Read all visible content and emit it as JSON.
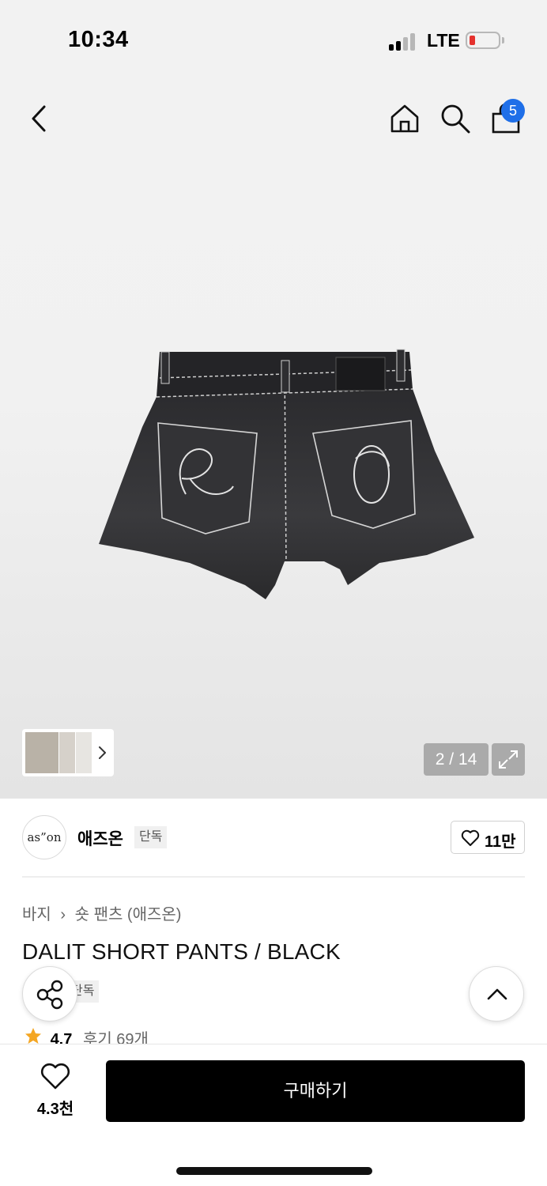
{
  "status_bar": {
    "time": "10:34",
    "network": "LTE",
    "battery_level": 0.15,
    "battery_color": "#e5322e"
  },
  "nav": {
    "back_icon": "chevron-left-icon",
    "home_icon": "home-icon",
    "search_icon": "search-icon",
    "cart_icon": "shopping-bag-icon",
    "cart_badge": "5",
    "badge_color": "#1f6fe8"
  },
  "gallery": {
    "page_counter": "2 / 14",
    "expand_icon": "expand-icon",
    "thumbnail_more_icon": "chevron-right-icon"
  },
  "brand": {
    "logo_text": "as”on",
    "name": "애즈온",
    "tag": "단독",
    "like_count": "11만"
  },
  "product": {
    "breadcrumb": [
      "바지",
      "숏 팬츠 (애즈온)"
    ],
    "title": "DALIT SHORT PANTS / BLACK",
    "exclusive_tag": "단독",
    "rating": "4.7",
    "review_label": "후기 69개"
  },
  "bottom_bar": {
    "wish_count": "4.3천",
    "buy_label": "구매하기"
  }
}
